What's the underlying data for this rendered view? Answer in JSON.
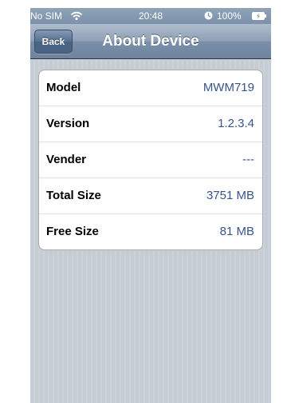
{
  "status_bar": {
    "carrier": "No SIM",
    "time": "20:48",
    "battery": "100%"
  },
  "nav_bar": {
    "back_label": "Back",
    "title": "About Device"
  },
  "device_info": {
    "rows": [
      {
        "label": "Model",
        "value": "MWM719"
      },
      {
        "label": "Version",
        "value": "1.2.3.4"
      },
      {
        "label": "Vender",
        "value": "---"
      },
      {
        "label": "Total Size",
        "value": "3751 MB"
      },
      {
        "label": "Free Size",
        "value": "81 MB"
      }
    ]
  },
  "icons": {
    "wifi": "wifi-icon",
    "alarm": "alarm-icon",
    "battery": "battery-icon"
  },
  "colors": {
    "value_text": "#385487",
    "background": "#c5ccd4",
    "nav_bar": "#6d84a0"
  }
}
